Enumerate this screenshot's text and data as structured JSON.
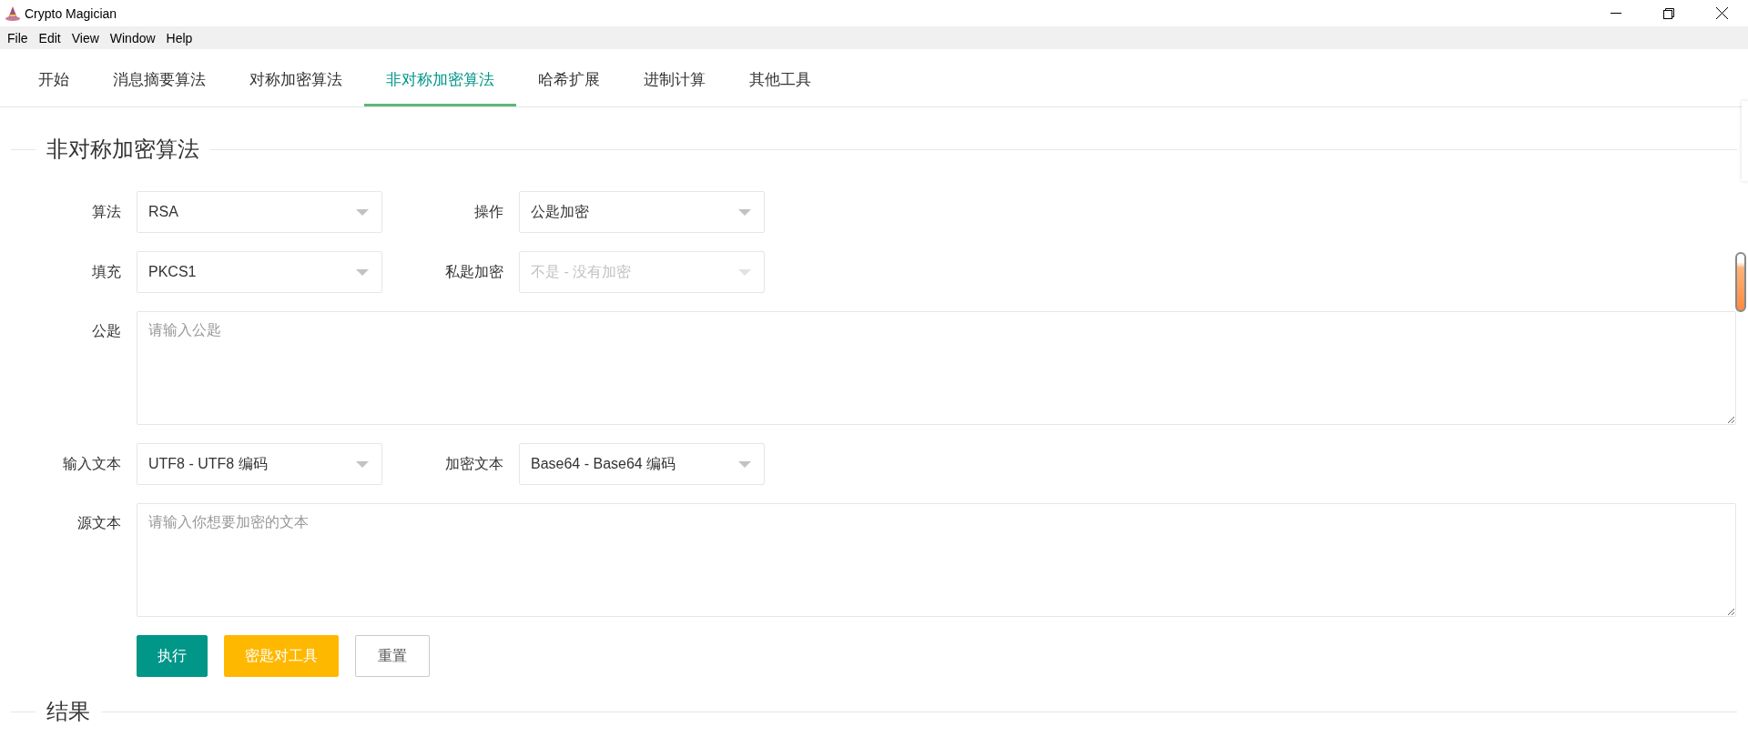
{
  "window": {
    "title": "Crypto Magician"
  },
  "menu": [
    "File",
    "Edit",
    "View",
    "Window",
    "Help"
  ],
  "tabs": [
    {
      "label": "开始",
      "selected": false
    },
    {
      "label": "消息摘要算法",
      "selected": false
    },
    {
      "label": "对称加密算法",
      "selected": false
    },
    {
      "label": "非对称加密算法",
      "selected": true
    },
    {
      "label": "哈希扩展",
      "selected": false
    },
    {
      "label": "进制计算",
      "selected": false
    },
    {
      "label": "其他工具",
      "selected": false
    }
  ],
  "section": {
    "title": "非对称加密算法"
  },
  "form_rows": [
    {
      "fields": [
        {
          "kind": "select",
          "label": "算法",
          "value": "RSA",
          "disabled": false
        },
        {
          "kind": "select",
          "label": "操作",
          "value": "公匙加密",
          "disabled": false
        }
      ]
    },
    {
      "fields": [
        {
          "kind": "select",
          "label": "填充",
          "value": "PKCS1",
          "disabled": false
        },
        {
          "kind": "select",
          "label": "私匙加密",
          "value": "不是 - 没有加密",
          "disabled": true
        }
      ]
    },
    {
      "fields": [
        {
          "kind": "textarea",
          "label": "公匙",
          "placeholder": "请输入公匙"
        }
      ]
    },
    {
      "fields": [
        {
          "kind": "select",
          "label": "输入文本",
          "value": "UTF8 - UTF8 编码",
          "disabled": false
        },
        {
          "kind": "select",
          "label": "加密文本",
          "value": "Base64 - Base64 编码",
          "disabled": false
        }
      ]
    },
    {
      "fields": [
        {
          "kind": "textarea",
          "label": "源文本",
          "placeholder": "请输入你想要加密的文本"
        }
      ]
    }
  ],
  "buttons": [
    {
      "label": "执行",
      "kind": "primary"
    },
    {
      "label": "密匙对工具",
      "kind": "warning"
    },
    {
      "label": "重置",
      "kind": "default"
    }
  ],
  "result": {
    "title": "结果"
  }
}
